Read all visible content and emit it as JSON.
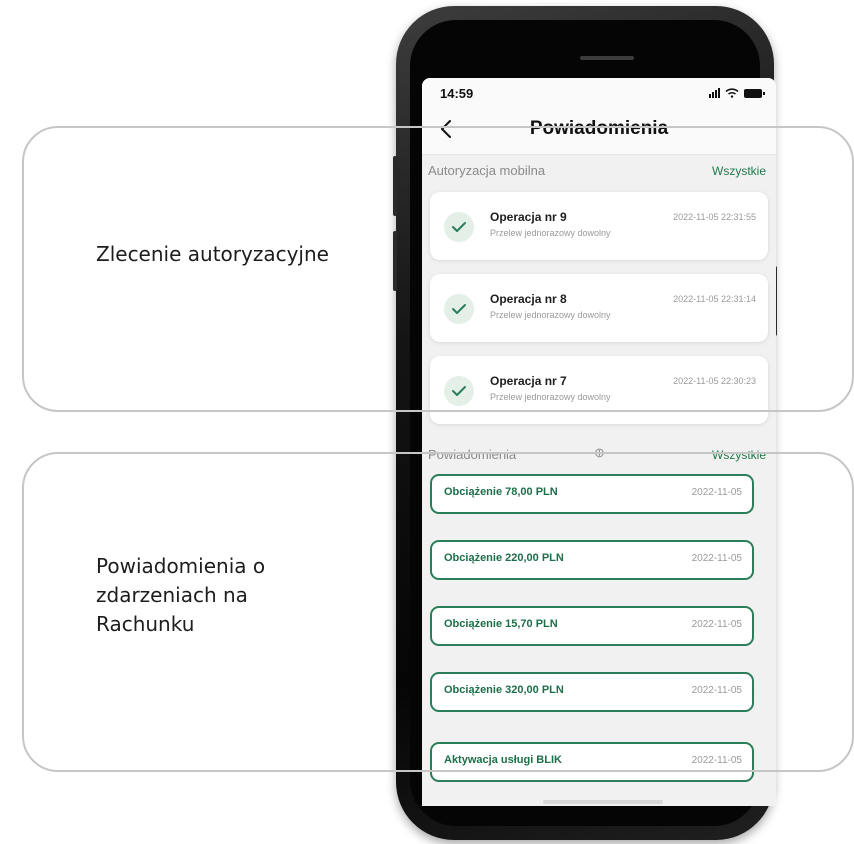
{
  "callouts": {
    "authorization": {
      "label": "Zlecenie autoryzacyjne"
    },
    "notifications": {
      "label_lines": [
        "Powiadomienia o",
        "zdarzeniach na",
        "Rachunku"
      ]
    }
  },
  "status_bar": {
    "time": "14:59"
  },
  "app_bar": {
    "title": "Powiadomienia",
    "back_icon": "chevron-left-icon"
  },
  "auth_section": {
    "title": "Autoryzacja mobilna",
    "link": "Wszystkie",
    "items": [
      {
        "title": "Operacja nr 9",
        "subtitle": "Przelew jednorazowy dowolny",
        "date": "2022-11-05 22:31:55"
      },
      {
        "title": "Operacja nr 8",
        "subtitle": "Przelew jednorazowy dowolny",
        "date": "2022-11-05 22:31:14"
      },
      {
        "title": "Operacja nr 7",
        "subtitle": "Przelew jednorazowy dowolny",
        "date": "2022-11-05 22:30:23"
      }
    ]
  },
  "notif_section": {
    "title": "Powiadomienia",
    "link": "Wszystkie",
    "items": [
      {
        "title": "Obciążenie 78,00 PLN",
        "date": "2022-11-05"
      },
      {
        "title": "Obciążenie 220,00 PLN",
        "date": "2022-11-05"
      },
      {
        "title": "Obciążenie 15,70 PLN",
        "date": "2022-11-05"
      },
      {
        "title": "Obciążenie 320,00 PLN",
        "date": "2022-11-05"
      },
      {
        "title": "Aktywacja usługi BLIK",
        "date": "2022-11-05"
      }
    ]
  },
  "colors": {
    "accent": "#1f7a4a",
    "card_border": "#2b7e5a",
    "callout_border": "#c6c6c6"
  }
}
